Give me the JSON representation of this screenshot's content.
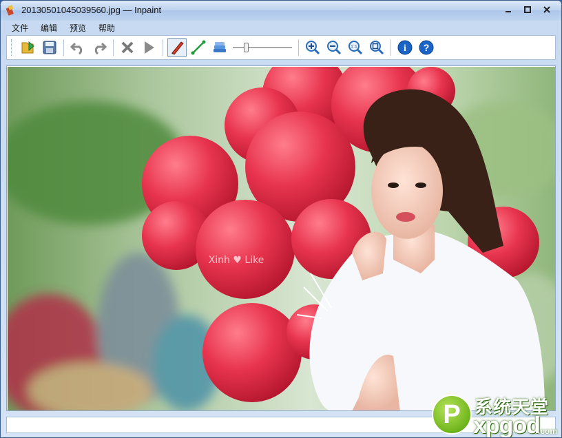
{
  "window": {
    "title": "20130501045039560.jpg — Inpaint",
    "minimize_label": "—",
    "maximize_label": "□",
    "close_label": "✕"
  },
  "menu": {
    "items": [
      {
        "label": "文件"
      },
      {
        "label": "编辑"
      },
      {
        "label": "预览"
      },
      {
        "label": "帮助"
      }
    ]
  },
  "toolbar": {
    "buttons": [
      {
        "icon": "open-icon"
      },
      {
        "icon": "save-icon"
      },
      {
        "icon": "undo-icon"
      },
      {
        "icon": "redo-icon"
      },
      {
        "icon": "erase-icon"
      },
      {
        "icon": "run-icon"
      },
      {
        "icon": "marker-icon"
      },
      {
        "icon": "line-icon"
      },
      {
        "icon": "layers-icon"
      },
      {
        "icon": "zoom-in-icon"
      },
      {
        "icon": "zoom-out-icon"
      },
      {
        "icon": "zoom-actual-icon",
        "text": "1:1"
      },
      {
        "icon": "zoom-fit-icon"
      },
      {
        "icon": "info-icon",
        "text": "i"
      },
      {
        "icon": "help-icon",
        "text": "?"
      }
    ],
    "brush_size_level": 0.2
  },
  "image": {
    "caption": "Xinh ♥ Like",
    "colors": {
      "balloon": "#e8344e",
      "background": "#9fbf8a"
    }
  },
  "status": {
    "text": ""
  },
  "watermark": {
    "circle_letter": "P",
    "chinese": "系统天堂",
    "latin": "xpgod",
    "suffix": ".com"
  },
  "colors": {
    "titlebar": "#bcd2ef",
    "accent_blue": "#1a64c8",
    "accent_green": "#5bb51e"
  }
}
